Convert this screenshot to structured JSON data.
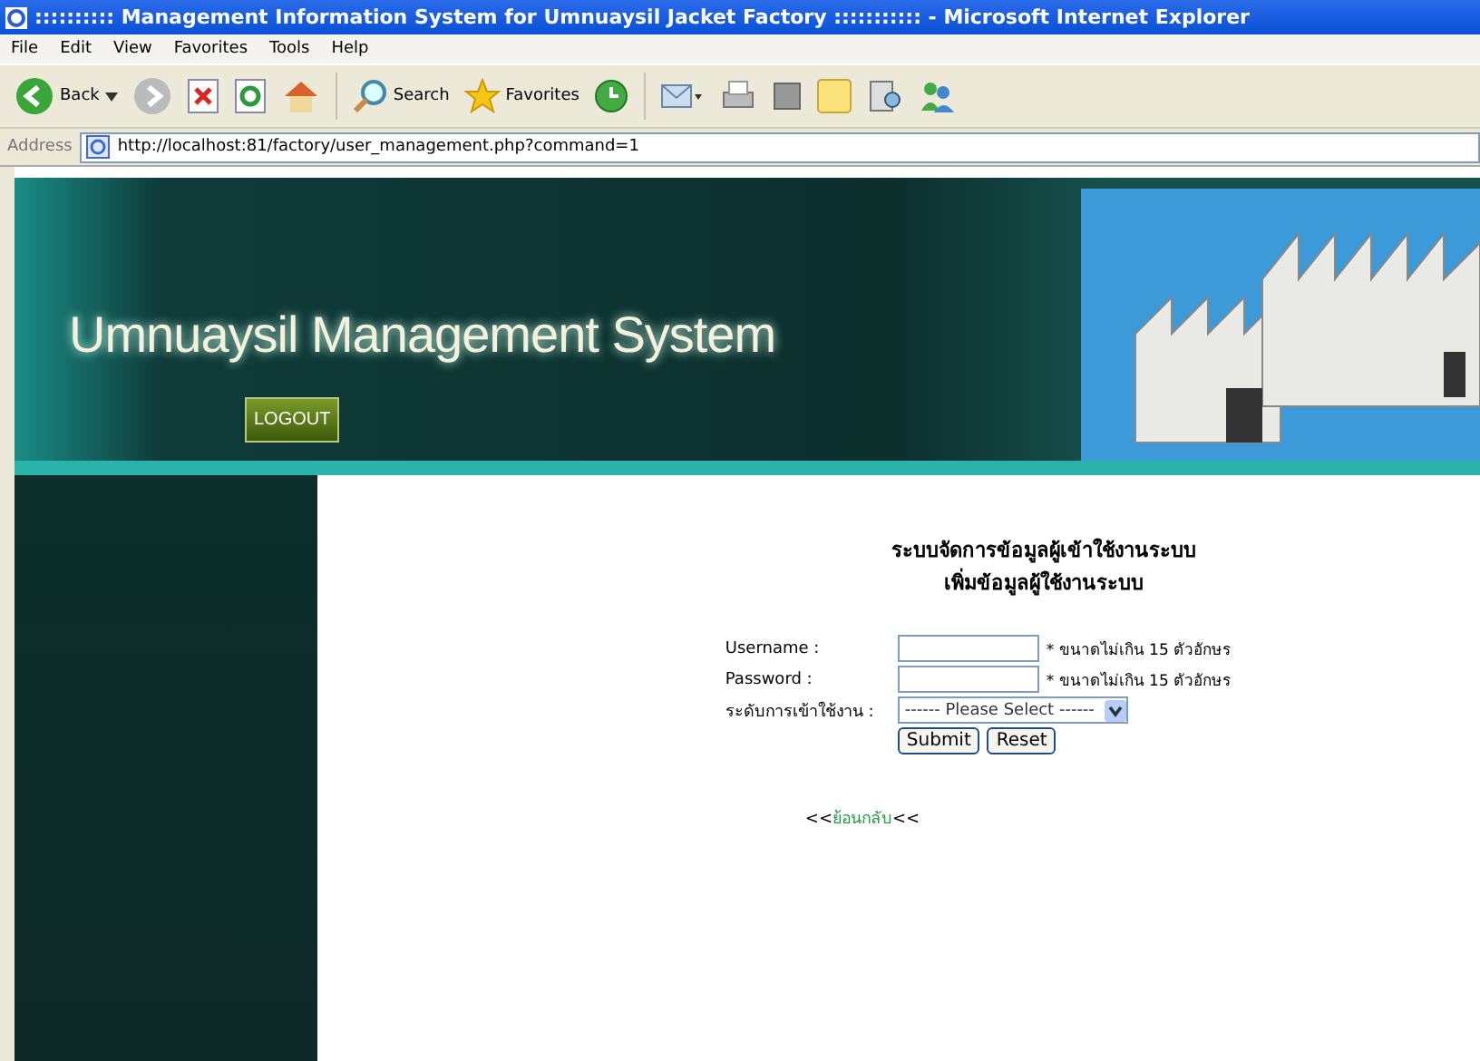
{
  "window": {
    "title": ":::::::::: Management Information System for Umnuaysil Jacket Factory ::::::::::: - Microsoft Internet Explorer"
  },
  "menu": [
    "File",
    "Edit",
    "View",
    "Favorites",
    "Tools",
    "Help"
  ],
  "toolbar": {
    "back": "Back",
    "search": "Search",
    "favorites": "Favorites"
  },
  "address": {
    "label": "Address",
    "url": "http://localhost:81/factory/user_management.php?command=1"
  },
  "header": {
    "title": "Umnuaysil Management System",
    "logout": "LOGOUT"
  },
  "form": {
    "heading": [
      "ระบบจัดการข้อมูลผู้เข้าใช้งานระบบ",
      "เพิ่มข้อมูลผู้ใช้งานระบบ"
    ],
    "fields": [
      {
        "kind": "text",
        "label": "Username :",
        "hint": "* ขนาดไม่เกิน 15 ตัวอักษร"
      },
      {
        "kind": "password",
        "label": "Password :",
        "hint": "* ขนาดไม่เกิน 15 ตัวอักษร"
      },
      {
        "kind": "select",
        "label": "ระดับการเข้าใช้งาน :",
        "value": "------ Please Select ------"
      }
    ],
    "buttons": [
      "Submit",
      "Reset"
    ],
    "back_link": {
      "prefix": "<<",
      "label": "ย้อนกลับ",
      "suffix": "<<"
    }
  }
}
